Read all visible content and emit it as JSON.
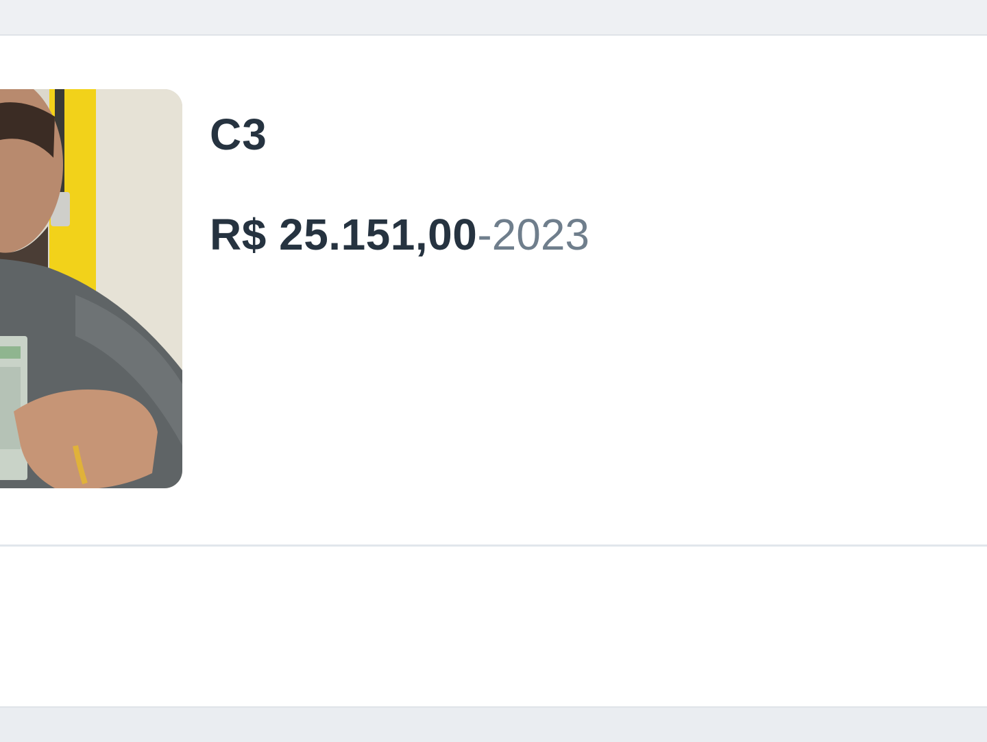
{
  "listing": {
    "title": "C3",
    "price": "R$ 25.151,00",
    "separator": "-",
    "year": "2023",
    "photo_icon": "winner-photo"
  },
  "colors": {
    "text_primary": "#263340",
    "text_muted": "#6f7e8c",
    "background": "#eef0f3",
    "card": "#ffffff",
    "divider": "#e1e6ec"
  }
}
